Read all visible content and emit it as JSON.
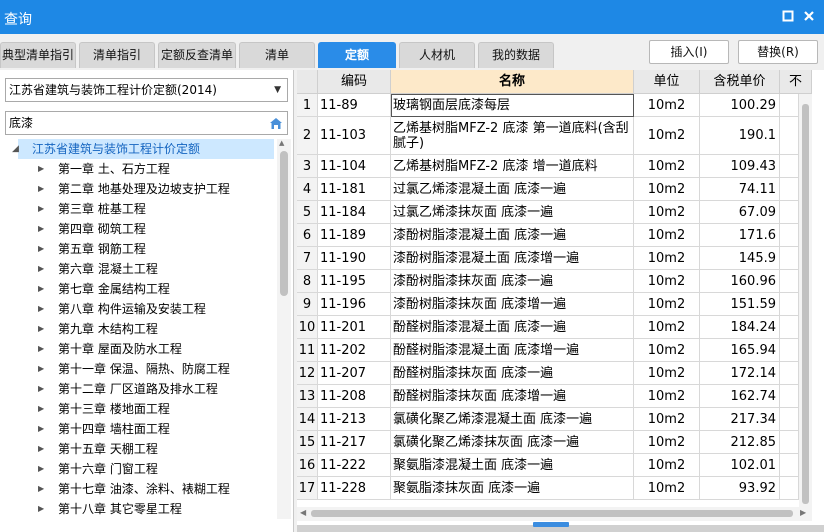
{
  "window": {
    "title": "查询"
  },
  "tabs": [
    {
      "label": "典型清单指引",
      "active": false
    },
    {
      "label": "清单指引",
      "active": false
    },
    {
      "label": "定额反查清单",
      "active": false
    },
    {
      "label": "清单",
      "active": false
    },
    {
      "label": "定额",
      "active": true
    },
    {
      "label": "人材机",
      "active": false
    },
    {
      "label": "我的数据",
      "active": false
    }
  ],
  "actions": {
    "insert": "插入(I)",
    "replace": "替换(R)"
  },
  "left": {
    "quota_select": "江苏省建筑与装饰工程计价定额(2014)",
    "search_value": "底漆",
    "tree_root": "江苏省建筑与装饰工程计价定额",
    "chapters": [
      "第一章 土、石方工程",
      "第二章 地基处理及边坡支护工程",
      "第三章 桩基工程",
      "第四章 砌筑工程",
      "第五章 钢筋工程",
      "第六章 混凝土工程",
      "第七章 金属结构工程",
      "第八章 构件运输及安装工程",
      "第九章 木结构工程",
      "第十章 屋面及防水工程",
      "第十一章 保温、隔热、防腐工程",
      "第十二章 厂区道路及排水工程",
      "第十三章 楼地面工程",
      "第十四章 墙柱面工程",
      "第十五章 天棚工程",
      "第十六章 门窗工程",
      "第十七章 油漆、涂料、裱糊工程",
      "第十八章 其它零星工程"
    ]
  },
  "grid": {
    "headers": {
      "code": "编码",
      "name": "名称",
      "unit": "单位",
      "price": "含税单价",
      "extra": "不"
    },
    "rows": [
      {
        "num": "1",
        "code": "11-89",
        "name": "玻璃钢面层底漆每层",
        "unit": "10m2",
        "price": "100.29"
      },
      {
        "num": "2",
        "code": "11-103",
        "name": "乙烯基树脂MFZ-2 底漆 第一道底料(含刮腻子)",
        "unit": "10m2",
        "price": "190.1"
      },
      {
        "num": "3",
        "code": "11-104",
        "name": "乙烯基树脂MFZ-2 底漆 增一道底料",
        "unit": "10m2",
        "price": "109.43"
      },
      {
        "num": "4",
        "code": "11-181",
        "name": "过氯乙烯漆混凝土面 底漆一遍",
        "unit": "10m2",
        "price": "74.11"
      },
      {
        "num": "5",
        "code": "11-184",
        "name": "过氯乙烯漆抹灰面 底漆一遍",
        "unit": "10m2",
        "price": "67.09"
      },
      {
        "num": "6",
        "code": "11-189",
        "name": "漆酚树脂漆混凝土面 底漆一遍",
        "unit": "10m2",
        "price": "171.6"
      },
      {
        "num": "7",
        "code": "11-190",
        "name": "漆酚树脂漆混凝土面 底漆增一遍",
        "unit": "10m2",
        "price": "145.9"
      },
      {
        "num": "8",
        "code": "11-195",
        "name": "漆酚树脂漆抹灰面 底漆一遍",
        "unit": "10m2",
        "price": "160.96"
      },
      {
        "num": "9",
        "code": "11-196",
        "name": "漆酚树脂漆抹灰面 底漆增一遍",
        "unit": "10m2",
        "price": "151.59"
      },
      {
        "num": "10",
        "code": "11-201",
        "name": "酚醛树脂漆混凝土面 底漆一遍",
        "unit": "10m2",
        "price": "184.24"
      },
      {
        "num": "11",
        "code": "11-202",
        "name": "酚醛树脂漆混凝土面 底漆增一遍",
        "unit": "10m2",
        "price": "165.94"
      },
      {
        "num": "12",
        "code": "11-207",
        "name": "酚醛树脂漆抹灰面 底漆一遍",
        "unit": "10m2",
        "price": "172.14"
      },
      {
        "num": "13",
        "code": "11-208",
        "name": "酚醛树脂漆抹灰面 底漆增一遍",
        "unit": "10m2",
        "price": "162.74"
      },
      {
        "num": "14",
        "code": "11-213",
        "name": "氯磺化聚乙烯漆混凝土面 底漆一遍",
        "unit": "10m2",
        "price": "217.34"
      },
      {
        "num": "15",
        "code": "11-217",
        "name": "氯磺化聚乙烯漆抹灰面 底漆一遍",
        "unit": "10m2",
        "price": "212.85"
      },
      {
        "num": "16",
        "code": "11-222",
        "name": "聚氨脂漆混凝土面 底漆一遍",
        "unit": "10m2",
        "price": "102.01"
      },
      {
        "num": "17",
        "code": "11-228",
        "name": "聚氨脂漆抹灰面 底漆一遍",
        "unit": "10m2",
        "price": "93.92"
      }
    ]
  }
}
